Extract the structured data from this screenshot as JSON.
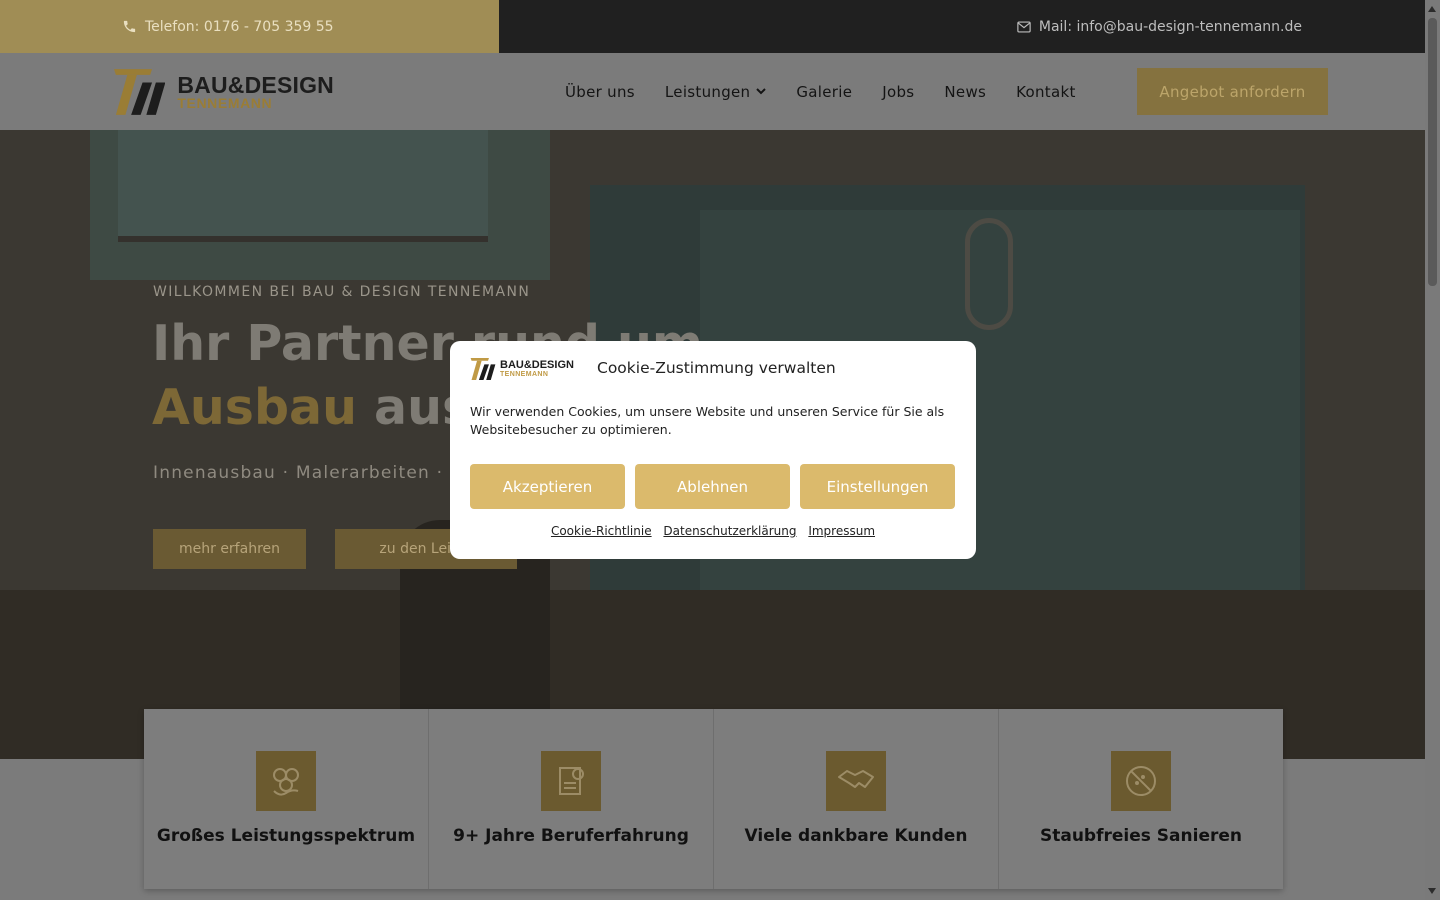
{
  "topbar": {
    "phone": "Telefon: 0176 - 705 359 55",
    "mail": "Mail: info@bau-design-tennemann.de"
  },
  "header": {
    "logo_line1": "BAU&DESIGN",
    "logo_line2": "TENNEMANN",
    "nav": [
      "Über uns",
      "Leistungen",
      "Galerie",
      "Jobs",
      "News",
      "Kontakt"
    ],
    "cta": "Angebot anfordern"
  },
  "hero": {
    "kicker": "WILLKOMMEN BEI BAU & DESIGN TENNEMANN",
    "headline_line1": "Ihr Partner rund um",
    "headline_gold": "Ausbau",
    "headline_rest": " aus",
    "subline": "Innenausbau · Malerarbeiten · Fl",
    "btn_more": "mehr erfahren",
    "btn_services": "zu den Leistu"
  },
  "features": [
    {
      "title": "Großes Leistungsspektrum",
      "icon": "gears-hand-icon"
    },
    {
      "title": "9+ Jahre Beruferfahrung",
      "icon": "certificate-icon"
    },
    {
      "title": "Viele dankbare Kunden",
      "icon": "handshake-icon"
    },
    {
      "title": "Staubfreies Sanieren",
      "icon": "no-dust-icon"
    }
  ],
  "cookie": {
    "logo_line1": "BAU&DESIGN",
    "logo_line2": "TENNEMANN",
    "title": "Cookie-Zustimmung verwalten",
    "text": "Wir verwenden Cookies, um unsere Website und unseren Service für Sie als Websitebesucher zu optimieren.",
    "accept": "Akzeptieren",
    "deny": "Ablehnen",
    "settings": "Einstellungen",
    "links": [
      "Cookie-Richtlinie",
      "Datenschutzerklärung",
      "Impressum"
    ]
  },
  "colors": {
    "gold": "#a08d55",
    "button_gold": "#dbba6c",
    "dark": "#202020"
  }
}
